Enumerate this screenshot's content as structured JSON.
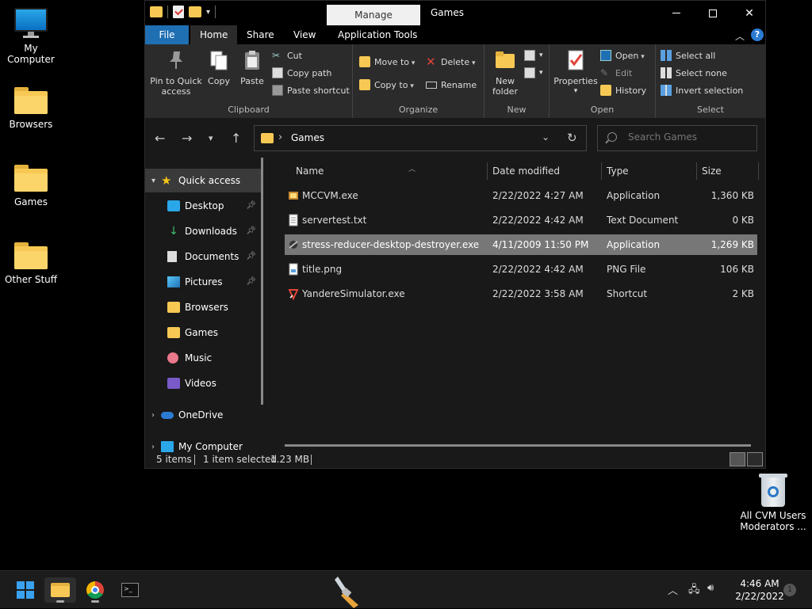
{
  "desktop": {
    "icons": [
      {
        "label": "My Computer"
      },
      {
        "label": "Browsers"
      },
      {
        "label": "Games"
      },
      {
        "label": "Other Stuff"
      }
    ],
    "recycle_bin": {
      "line1": "All CVM Users",
      "line2": "Moderators ..."
    }
  },
  "window": {
    "title": "Games",
    "manage_tab": "Manage",
    "menu_tabs": {
      "file": "File",
      "home": "Home",
      "share": "Share",
      "view": "View",
      "app_tools": "Application Tools"
    },
    "help": "?",
    "ribbon": {
      "clipboard": {
        "label": "Clipboard",
        "pin": "Pin to Quick access",
        "copy": "Copy",
        "paste": "Paste",
        "cut": "Cut",
        "copy_path": "Copy path",
        "paste_shortcut": "Paste shortcut"
      },
      "organize": {
        "label": "Organize",
        "move_to": "Move to",
        "copy_to": "Copy to",
        "delete": "Delete",
        "rename": "Rename"
      },
      "new": {
        "label": "New",
        "new_folder": "New folder"
      },
      "open": {
        "label": "Open",
        "properties": "Properties",
        "open": "Open",
        "edit": "Edit",
        "history": "History"
      },
      "select": {
        "label": "Select",
        "select_all": "Select all",
        "select_none": "Select none",
        "invert": "Invert selection"
      }
    },
    "address": {
      "crumb": "Games"
    },
    "search": {
      "placeholder": "Search Games"
    },
    "nav": {
      "quick_access": "Quick access",
      "items": [
        {
          "label": "Desktop",
          "pinned": true
        },
        {
          "label": "Downloads",
          "pinned": true
        },
        {
          "label": "Documents",
          "pinned": true
        },
        {
          "label": "Pictures",
          "pinned": true
        },
        {
          "label": "Browsers",
          "pinned": false
        },
        {
          "label": "Games",
          "pinned": false
        },
        {
          "label": "Music",
          "pinned": false
        },
        {
          "label": "Videos",
          "pinned": false
        }
      ],
      "onedrive": "OneDrive",
      "my_computer": "My Computer"
    },
    "columns": {
      "name": "Name",
      "date": "Date modified",
      "type": "Type",
      "size": "Size"
    },
    "files": [
      {
        "name": "MCCVM.exe",
        "date": "2/22/2022 4:27 AM",
        "type": "Application",
        "size": "1,360 KB",
        "selected": false
      },
      {
        "name": "servertest.txt",
        "date": "2/22/2022 4:42 AM",
        "type": "Text Document",
        "size": "0 KB",
        "selected": false
      },
      {
        "name": "stress-reducer-desktop-destroyer.exe",
        "date": "4/11/2009 11:50 PM",
        "type": "Application",
        "size": "1,269 KB",
        "selected": true
      },
      {
        "name": "title.png",
        "date": "2/22/2022 4:42 AM",
        "type": "PNG File",
        "size": "106 KB",
        "selected": false
      },
      {
        "name": "YandereSimulator.exe",
        "date": "2/22/2022 3:58 AM",
        "type": "Shortcut",
        "size": "2 KB",
        "selected": false
      }
    ],
    "status": {
      "count": "5 items",
      "selected": "1 item selected",
      "size": "1.23 MB"
    }
  },
  "taskbar": {
    "time": "4:46 AM",
    "date": "2/22/2022",
    "notifications": "1"
  },
  "colors": {
    "accent": "#1f6fb3",
    "folder": "#f7c954",
    "selection": "#777777"
  }
}
